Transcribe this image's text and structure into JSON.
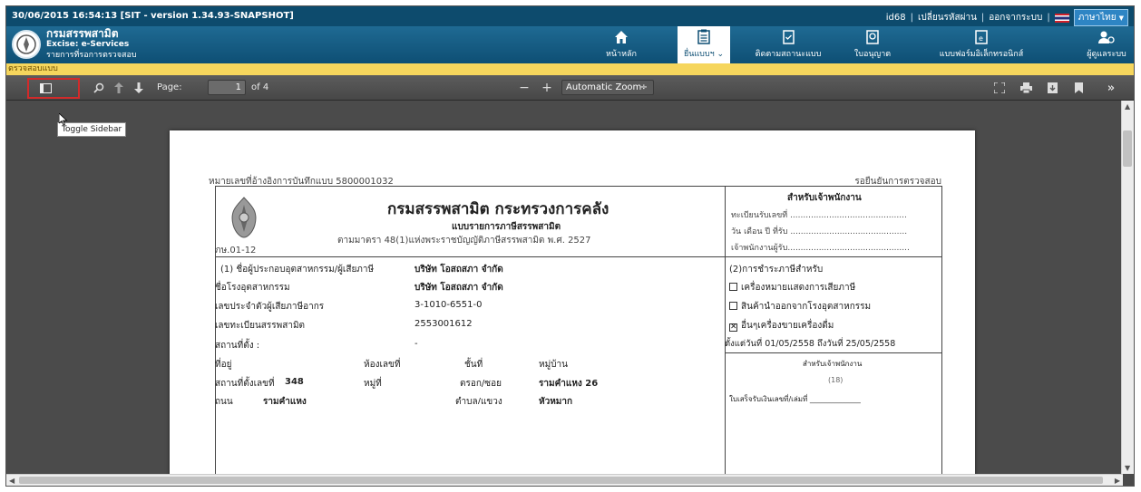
{
  "topbar": {
    "left_text": "30/06/2015 16:54:13   [SIT - version 1.34.93-SNAPSHOT]",
    "user": "id68",
    "change_password": "เปลี่ยนรหัสผ่าน",
    "logout": "ออกจากระบบ",
    "language": "ภาษาไทย"
  },
  "header": {
    "title": "กรมสรรพสามิต",
    "subtitle": "Excise: e-Services",
    "subtitle2": "รายการที่รอการตรวจสอบ",
    "nav": [
      {
        "label": "หน้าหลัก",
        "icon": "home-icon"
      },
      {
        "label": "ยื่นแบบฯ",
        "icon": "clipboard-icon",
        "active": true
      },
      {
        "label": "ติดตามสถานะแบบ",
        "icon": "track-doc-icon"
      },
      {
        "label": "ใบอนุญาต",
        "icon": "license-icon"
      },
      {
        "label": "แบบฟอร์มอิเล็กทรอนิกส์",
        "icon": "eform-icon"
      },
      {
        "label": "ผู้ดูแลระบบ",
        "icon": "admin-gear-icon"
      }
    ]
  },
  "yellow_bar": "ตรวจสอบแบบ",
  "pdf_toolbar": {
    "page_label": "Page:",
    "page_value": "1",
    "page_of": "of 4",
    "zoom": "Automatic Zoom",
    "tooltip": "Toggle Sidebar"
  },
  "document": {
    "ref_label": "หมายเลขที่อ้างอิงการบันทึกแบบ  5800001032",
    "status": "รอยืนยันการตรวจสอบ",
    "form_code": "ภษ.01-12",
    "main_title": "กรมสรรพสามิต กระทรวงการคลัง",
    "form_name": "แบบรายการภาษีสรรพสามิต",
    "law": "ตามมาตรา 48(1)แห่งพระราชบัญญัติภาษีสรรพสามิต พ.ศ. 2527",
    "officer_title": "สำหรับเจ้าพนักงาน",
    "officer_lines": [
      "ทะเบียนรับเลขที่ .............................................",
      "วัน เดือน ปี ที่รับ .............................................",
      "เจ้าพนักงานผู้รับ..............................................."
    ],
    "fields": [
      {
        "label": "(1) ชื่อผู้ประกอบอุตสาหกรรม/ผู้เสียภาษี",
        "value": "บริษัท โอสถสภา จำกัด"
      },
      {
        "label": "ชื่อโรงอุตสาหกรรม",
        "value": "บริษัท โอสถสภา จำกัด"
      },
      {
        "label": "เลขประจำตัวผู้เสียภาษีอากร",
        "value": "3-1010-6551-0"
      },
      {
        "label": "เลขทะเบียนสรรพสามิต",
        "value": "2553001612"
      },
      {
        "label": "สถานที่ตั้ง :",
        "value": "-"
      }
    ],
    "addr": {
      "row1": [
        "ที่อยู่",
        "ห้องเลขที่",
        "ชั้นที่",
        "หมู่บ้าน"
      ],
      "row2_label": "สถานที่ตั้งเลขที่",
      "row2_value": "348",
      "row2_moo": "หมู่ที่",
      "row2_soi": "ตรอก/ซอย",
      "row2_soi_value": "รามคำแหง 26",
      "row3_label": "ถนน",
      "row3_value": "รามคำแหง",
      "row3_tambon": "ตำบล/แขวง",
      "row3_tambon_value": "หัวหมาก"
    },
    "tax_title": "(2)การชำระภาษีสำหรับ",
    "tax_options": [
      {
        "label": "เครื่องหมายแสดงการเสียภาษี",
        "checked": false
      },
      {
        "label": "สินค้านำออกจากโรงอุตสาหกรรม",
        "checked": false
      },
      {
        "label": "อื่นๆเครื่องขายเครื่องดื่ม",
        "checked": true
      }
    ],
    "date_range": "ตั้งแต่วันที่ 01/05/2558 ถึงวันที่ 25/05/2558",
    "officer_title2": "สำหรับเจ้าพนักงาน",
    "officer_num": "(18)",
    "receipt": "ใบเสร็จรับเงินเลขที่/เล่มที่ ______________"
  }
}
